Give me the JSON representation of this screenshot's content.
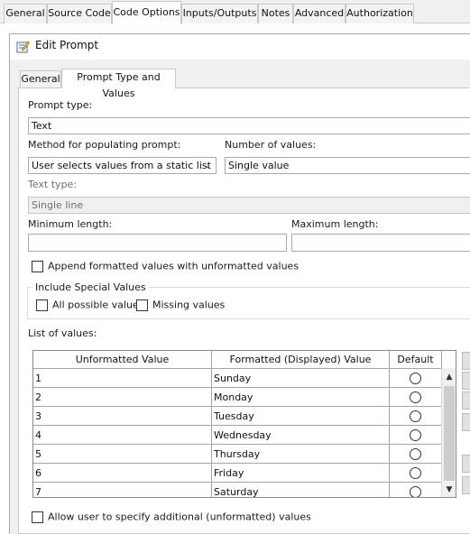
{
  "outer_tabs": [
    {
      "label": "General"
    },
    {
      "label": "Source Code"
    },
    {
      "label": "Code Options"
    },
    {
      "label": "Inputs/Outputs"
    },
    {
      "label": "Notes"
    },
    {
      "label": "Advanced"
    },
    {
      "label": "Authorization"
    }
  ],
  "outer_active_tab": "Code Options",
  "dialog": {
    "title": "Edit Prompt",
    "icon": "edit-prompt-icon"
  },
  "inner_tabs": [
    {
      "label": "General"
    },
    {
      "label": "Prompt Type and Values"
    }
  ],
  "inner_active_tab": "Prompt Type and Values",
  "form": {
    "prompt_type_label": "Prompt type:",
    "prompt_type_value": "Text",
    "method_label": "Method for populating prompt:",
    "method_value": "User selects values from a static list",
    "number_label": "Number of values:",
    "number_value": "Single value",
    "text_type_label": "Text type:",
    "text_type_value": "Single line",
    "min_length_label": "Minimum length:",
    "min_length_value": "",
    "max_length_label": "Maximum length:",
    "max_length_value": "",
    "append_label": "Append formatted values with unformatted values",
    "append_checked": false,
    "special_values_legend": "Include Special Values",
    "all_possible_label": "All possible values",
    "all_possible_checked": false,
    "missing_label": "Missing values",
    "missing_checked": false,
    "list_label": "List of values:",
    "allow_additional_label": "Allow user to specify additional (unformatted) values",
    "allow_additional_checked": false
  },
  "table": {
    "columns": [
      "Unformatted Value",
      "Formatted (Displayed) Value",
      "Default"
    ],
    "rows": [
      {
        "unformatted": "1",
        "formatted": "Sunday",
        "default": false
      },
      {
        "unformatted": "2",
        "formatted": "Monday",
        "default": false
      },
      {
        "unformatted": "3",
        "formatted": "Tuesday",
        "default": false
      },
      {
        "unformatted": "4",
        "formatted": "Wednesday",
        "default": false
      },
      {
        "unformatted": "5",
        "formatted": "Thursday",
        "default": false
      },
      {
        "unformatted": "6",
        "formatted": "Friday",
        "default": false
      },
      {
        "unformatted": "7",
        "formatted": "Saturday",
        "default": false
      }
    ]
  },
  "icons": {
    "dropdown": "chevron-down-icon",
    "scroll_up": "scroll-up-arrow-icon",
    "scroll_down": "scroll-down-arrow-icon"
  }
}
